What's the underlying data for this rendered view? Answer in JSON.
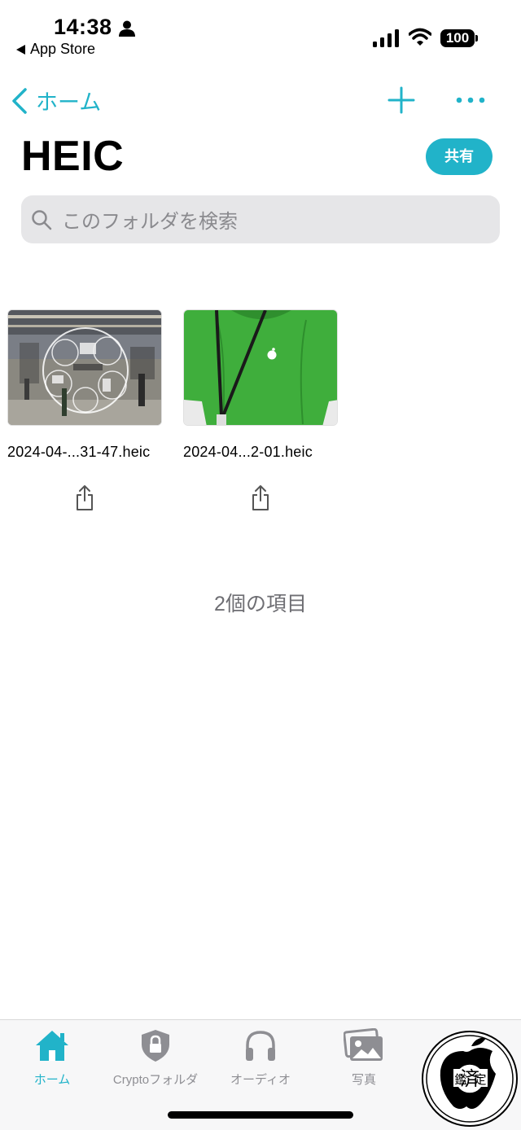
{
  "status_bar": {
    "time": "14:38",
    "back_app_label": "App Store",
    "battery_level": "100",
    "icons": [
      "person-icon",
      "signal-icon",
      "wifi-icon",
      "battery-icon"
    ]
  },
  "nav": {
    "back_label": "ホーム",
    "add_icon": "plus-icon",
    "more_icon": "ellipsis-icon"
  },
  "header": {
    "title": "HEIC",
    "share_label": "共有"
  },
  "search": {
    "placeholder": "このフォルダを検索"
  },
  "files": [
    {
      "name": "2024-04-...31-47.heic",
      "thumbnail": "apple-store-interior-photo",
      "share_icon": "share-icon"
    },
    {
      "name": "2024-04...2-01.heic",
      "thumbnail": "green-shirt-photo",
      "share_icon": "share-icon"
    }
  ],
  "item_count": "2個の項目",
  "tab_bar": {
    "tabs": [
      {
        "label": "ホーム",
        "icon": "home-icon",
        "active": true
      },
      {
        "label": "Cryptoフォルダ",
        "icon": "shield-lock-icon",
        "active": false
      },
      {
        "label": "オーディオ",
        "icon": "headphones-icon",
        "active": false
      },
      {
        "label": "写真",
        "icon": "photos-icon",
        "active": false
      }
    ]
  },
  "seal": {
    "chars": [
      "鑑",
      "済",
      "定"
    ]
  },
  "colors": {
    "accent": "#21b3c9",
    "search_bg": "#e6e6e8",
    "tab_inactive": "#8e8e93"
  }
}
